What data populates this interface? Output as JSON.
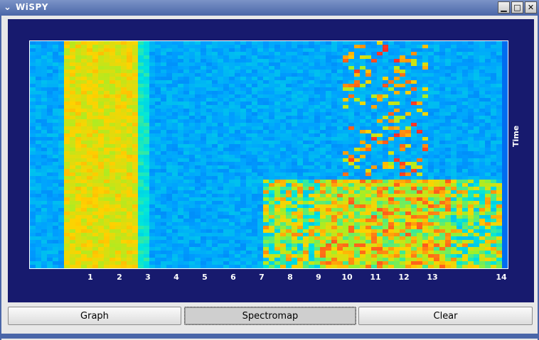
{
  "window": {
    "title": "WiSPY",
    "menu_icon": "chevron-down",
    "minimize_icon": "minimize",
    "maximize_icon": "maximize",
    "close_icon": "close",
    "title_bar_color": "#4a66a8"
  },
  "plot": {
    "background_color": "#171a6e",
    "ylabel": "Time",
    "x_ticks": [
      "1",
      "2",
      "3",
      "4",
      "5",
      "6",
      "7",
      "8",
      "9",
      "10",
      "11",
      "12",
      "13",
      "14"
    ]
  },
  "buttons": {
    "graph_label": "Graph",
    "spectromap_label": "Spectromap",
    "clear_label": "Clear"
  }
}
